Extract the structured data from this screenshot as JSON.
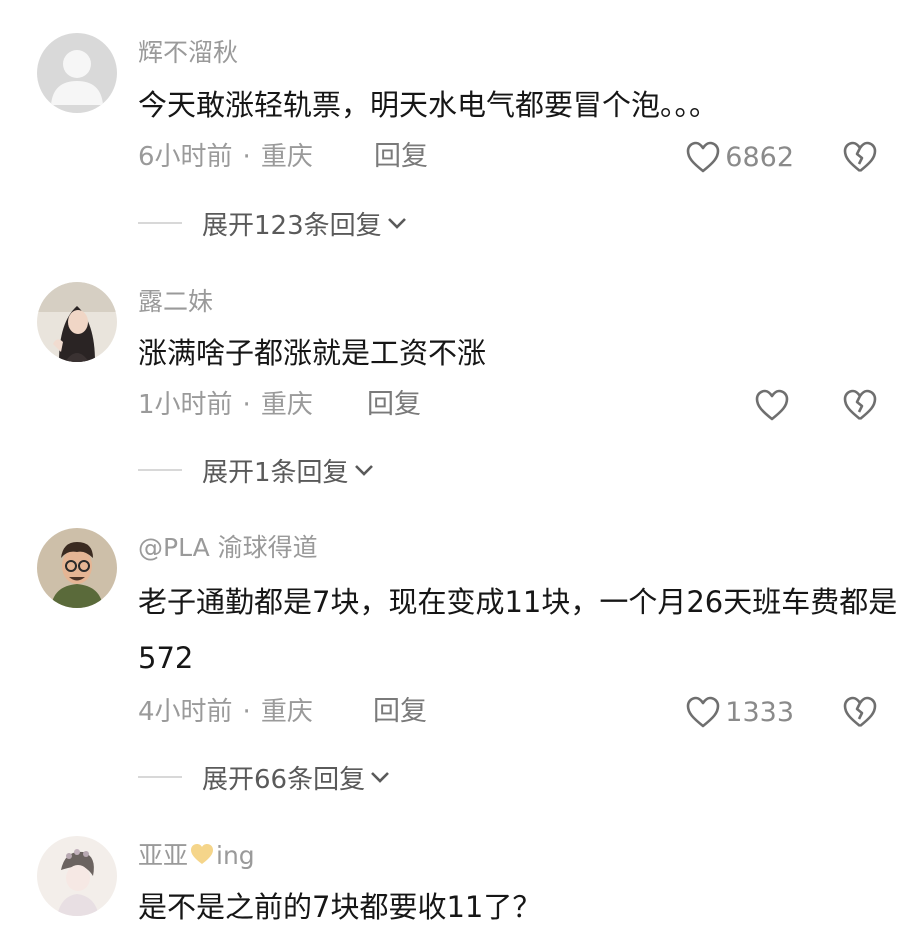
{
  "comments": [
    {
      "username": "辉不溜秋",
      "text": "今天敢涨轻轨票，明天水电气都要冒个泡。。。",
      "time": "6小时前",
      "separator": "·",
      "location": "重庆",
      "reply_label": "回复",
      "likes": "6862",
      "expand_label": "展开123条回复",
      "avatar_icon": "default-user-icon"
    },
    {
      "username": "露二妹",
      "text": "涨满啥子都涨就是工资不涨",
      "time": "1小时前",
      "separator": "·",
      "location": "重庆",
      "reply_label": "回复",
      "likes": "",
      "expand_label": "展开1条回复",
      "avatar_icon": "user-photo-woman"
    },
    {
      "username": "@PLA 渝球得道",
      "text": "老子通勤都是7块，现在变成11块，一个月26天班车费都是572",
      "time": "4小时前",
      "separator": "·",
      "location": "重庆",
      "reply_label": "回复",
      "likes": "1333",
      "expand_label": "展开66条回复",
      "avatar_icon": "cartoon-man-avatar"
    },
    {
      "username_prefix": "亚亚",
      "username_suffix": "ing",
      "username_emoji": "yellow-heart-icon",
      "text": "是不是之前的7块都要收11了？",
      "avatar_icon": "user-photo-girl-sketch"
    }
  ],
  "colors": {
    "text_primary": "#161616",
    "text_secondary": "#9a9a9a",
    "divider": "#d8d8d8",
    "yellow_heart": "#f5d58a"
  }
}
